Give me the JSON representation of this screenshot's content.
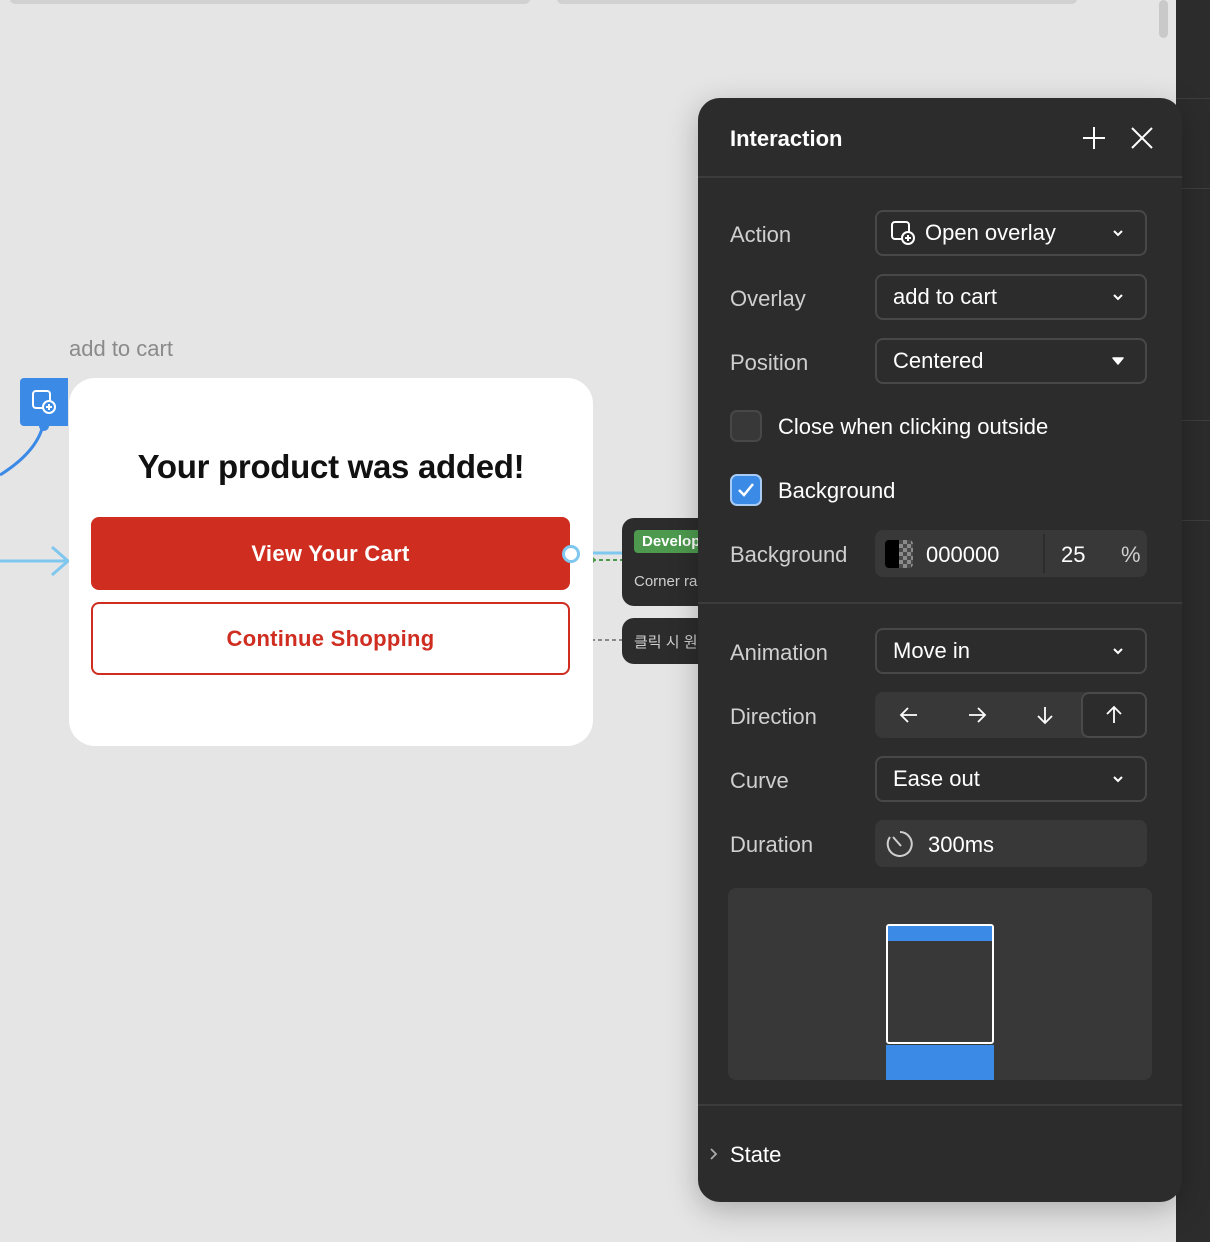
{
  "canvas": {
    "frame_label": "add to cart",
    "card": {
      "title": "Your product was added!",
      "primary_button": "View Your Cart",
      "secondary_button": "Continue Shopping"
    },
    "dev_notes": [
      {
        "tag": "Develop",
        "text": "Corner ra"
      },
      {
        "text": "클릭 시 원"
      }
    ]
  },
  "panel": {
    "title": "Interaction",
    "action": {
      "label": "Action",
      "value": "Open overlay"
    },
    "overlay": {
      "label": "Overlay",
      "value": "add to cart"
    },
    "position": {
      "label": "Position",
      "value": "Centered"
    },
    "close_outside": {
      "label": "Close when clicking outside",
      "checked": false
    },
    "background_toggle": {
      "label": "Background",
      "checked": true
    },
    "background_color": {
      "label": "Background",
      "hex": "000000",
      "opacity": "25",
      "unit": "%"
    },
    "animation": {
      "label": "Animation",
      "value": "Move in"
    },
    "direction": {
      "label": "Direction",
      "options": [
        "left",
        "right",
        "down",
        "up"
      ],
      "selected": "up"
    },
    "curve": {
      "label": "Curve",
      "value": "Ease out"
    },
    "duration": {
      "label": "Duration",
      "value": "300ms"
    },
    "state": {
      "label": "State"
    }
  },
  "colors": {
    "accent": "#3b8ae6",
    "brand_red": "#cf2d20",
    "panel_bg": "#2c2c2c",
    "canvas_bg": "#e5e5e5",
    "dev_tag_green": "#4d9a4f"
  }
}
